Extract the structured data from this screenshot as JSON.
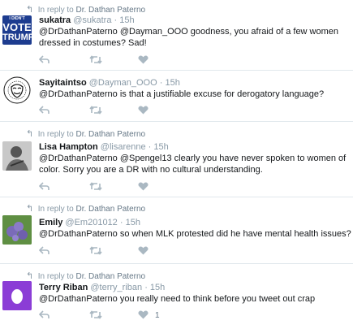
{
  "reply_prefix": "In reply to",
  "tweets": [
    {
      "replying_to": "Dr. Dathan Paterno",
      "name": "sukatra",
      "handle": "@sukatra",
      "time": "15h",
      "text": "@DrDathanPaterno @Dayman_OOO goodness, you afraid of a few women dressed in costumes? Sad!",
      "avatar_text": [
        "I DIDN'T",
        "VOTE",
        "TRUMP"
      ],
      "like_count": ""
    },
    {
      "replying_to": "",
      "name": "Sayitaintso",
      "handle": "@Dayman_OOO",
      "time": "15h",
      "text": "@DrDathanPaterno is that a justifiable excuse for derogatory language?",
      "avatar_text": [],
      "like_count": ""
    },
    {
      "replying_to": "Dr. Dathan Paterno",
      "name": "Lisa Hampton",
      "handle": "@lisarenne",
      "time": "15h",
      "text": "@DrDathanPaterno @Spengel13  clearly you have never spoken to women of color. Sorry you are a DR with no cultural understanding.",
      "avatar_text": [],
      "like_count": ""
    },
    {
      "replying_to": "Dr. Dathan Paterno",
      "name": "Emily",
      "handle": "@Em201012",
      "time": "15h",
      "text": "@DrDathanPaterno so when MLK protested did he have mental health issues?",
      "avatar_text": [],
      "like_count": ""
    },
    {
      "replying_to": "Dr. Dathan Paterno",
      "name": "Terry Riban",
      "handle": "@terry_riban",
      "time": "15h",
      "text": "@DrDathanPaterno you really need to think before you tweet out crap",
      "avatar_text": [],
      "like_count": "1"
    }
  ],
  "colors": {
    "muted": "#8899a6",
    "border": "#e1e8ed",
    "egg_purple": "#8b3dd6"
  }
}
